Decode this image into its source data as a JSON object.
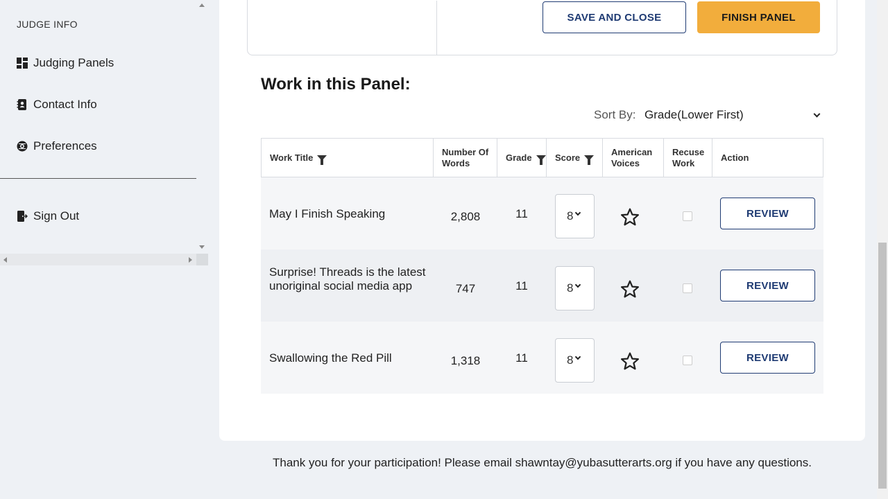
{
  "sidebar": {
    "heading": "JUDGE INFO",
    "items": [
      {
        "label": "Judging Panels",
        "icon": "dashboard-icon"
      },
      {
        "label": "Contact Info",
        "icon": "contact-book-icon"
      },
      {
        "label": "Preferences",
        "icon": "gear-icon"
      }
    ],
    "sign_out": {
      "label": "Sign Out",
      "icon": "sign-out-icon"
    }
  },
  "panel": {
    "save_label": "SAVE AND CLOSE",
    "finish_label": "FINISH PANEL"
  },
  "work": {
    "title": "Work in this Panel:",
    "sort_label": "Sort By:",
    "sort_value": "Grade(Lower First)",
    "columns": {
      "title": "Work Title",
      "words": "Number Of Words",
      "grade": "Grade",
      "score": "Score",
      "american_voices": "American Voices",
      "recuse": "Recuse Work",
      "action": "Action"
    },
    "rows": [
      {
        "title": "May I Finish Speaking",
        "words": "2,808",
        "grade": "11",
        "score": "8",
        "review": "REVIEW"
      },
      {
        "title": "Surprise! Threads is the latest unoriginal social media app",
        "words": "747",
        "grade": "11",
        "score": "8",
        "review": "REVIEW"
      },
      {
        "title": "Swallowing the Red Pill",
        "words": "1,318",
        "grade": "11",
        "score": "8",
        "review": "REVIEW"
      }
    ]
  },
  "footer": {
    "text": "Thank you for your participation! Please email shawntay@yubasutterarts.org if you have any questions."
  },
  "colors": {
    "accent": "#f2ad3c",
    "primary": "#1f3b73",
    "background": "#eef1f5"
  }
}
